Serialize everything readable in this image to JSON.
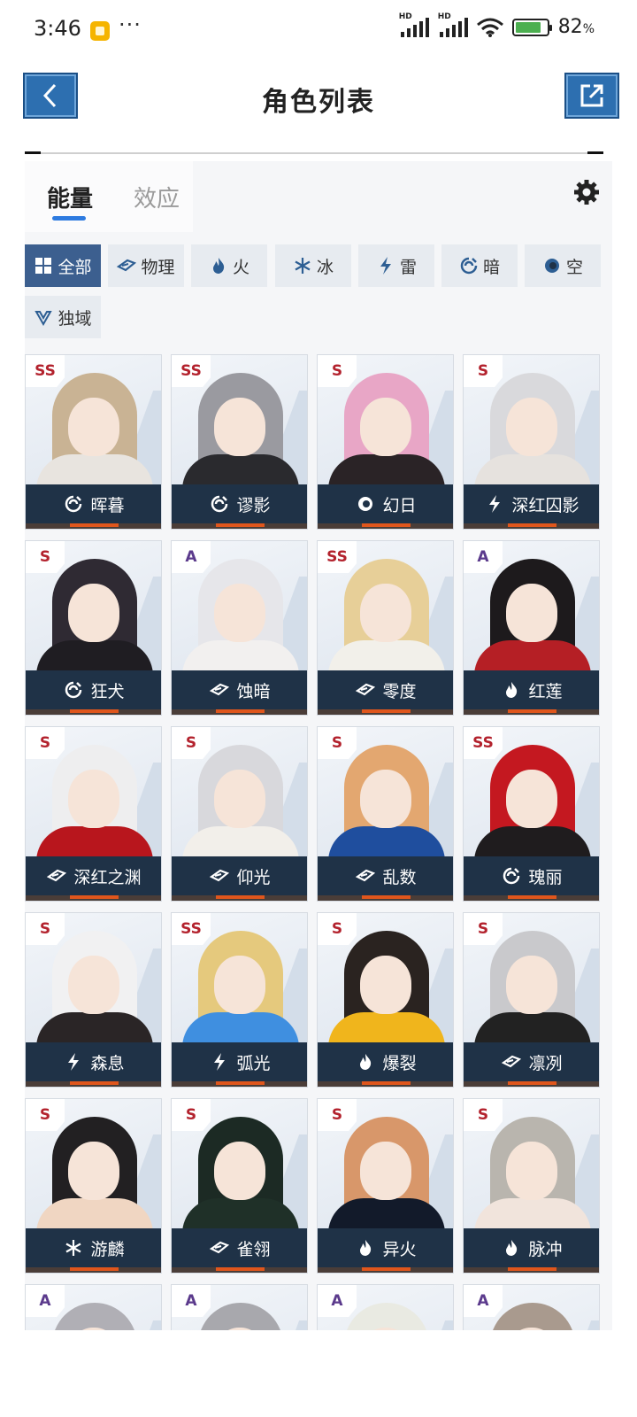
{
  "status_bar": {
    "time": "3:46",
    "dots": "···",
    "signal1_hd": "HD",
    "signal2_hd": "HD",
    "battery_pct": "82",
    "battery_unit": "%",
    "battery_level": 0.82
  },
  "header": {
    "title": "角色列表",
    "back_icon": "chevron-left-icon",
    "share_icon": "external-link-icon",
    "button_color": "#2d6fb0"
  },
  "tabs": [
    {
      "label": "能量",
      "active": true
    },
    {
      "label": "效应",
      "active": false
    }
  ],
  "settings_icon": "gear-icon",
  "filters": [
    {
      "label": "全部",
      "icon": "grid-icon",
      "active": true
    },
    {
      "label": "物理",
      "icon": "physical-icon",
      "active": false
    },
    {
      "label": "火",
      "icon": "fire-icon",
      "active": false
    },
    {
      "label": "冰",
      "icon": "snowflake-icon",
      "active": false
    },
    {
      "label": "雷",
      "icon": "lightning-icon",
      "active": false
    },
    {
      "label": "暗",
      "icon": "dark-icon",
      "active": false
    },
    {
      "label": "空",
      "icon": "void-icon",
      "active": false
    },
    {
      "label": "独域",
      "icon": "unique-icon",
      "active": false
    }
  ],
  "characters": [
    {
      "rank": "SS",
      "name": "晖暮",
      "element": "dark"
    },
    {
      "rank": "SS",
      "name": "谬影",
      "element": "dark"
    },
    {
      "rank": "S",
      "name": "幻日",
      "element": "void"
    },
    {
      "rank": "S",
      "name": "深红囚影",
      "element": "lightning"
    },
    {
      "rank": "S",
      "name": "狂犬",
      "element": "dark"
    },
    {
      "rank": "A",
      "name": "蚀暗",
      "element": "physical"
    },
    {
      "rank": "SS",
      "name": "零度",
      "element": "physical"
    },
    {
      "rank": "A",
      "name": "红莲",
      "element": "fire"
    },
    {
      "rank": "S",
      "name": "深红之渊",
      "element": "physical"
    },
    {
      "rank": "S",
      "name": "仰光",
      "element": "physical"
    },
    {
      "rank": "S",
      "name": "乱数",
      "element": "physical"
    },
    {
      "rank": "SS",
      "name": "瑰丽",
      "element": "dark"
    },
    {
      "rank": "S",
      "name": "森息",
      "element": "lightning"
    },
    {
      "rank": "SS",
      "name": "弧光",
      "element": "lightning"
    },
    {
      "rank": "S",
      "name": "爆裂",
      "element": "fire"
    },
    {
      "rank": "S",
      "name": "凛冽",
      "element": "physical"
    },
    {
      "rank": "S",
      "name": "游麟",
      "element": "ice"
    },
    {
      "rank": "S",
      "name": "雀翎",
      "element": "physical"
    },
    {
      "rank": "S",
      "name": "异火",
      "element": "fire"
    },
    {
      "rank": "S",
      "name": "脉冲",
      "element": "fire"
    },
    {
      "rank": "A",
      "name": "",
      "element": ""
    },
    {
      "rank": "A",
      "name": "",
      "element": ""
    },
    {
      "rank": "A",
      "name": "",
      "element": ""
    },
    {
      "rank": "A",
      "name": "",
      "element": ""
    }
  ],
  "colors": {
    "active_filter": "#3c5f8f",
    "tab_underline": "#2e7be0",
    "rank_text": "#b3222d",
    "namebar": "#1f3247",
    "accent": "#e0561c"
  }
}
